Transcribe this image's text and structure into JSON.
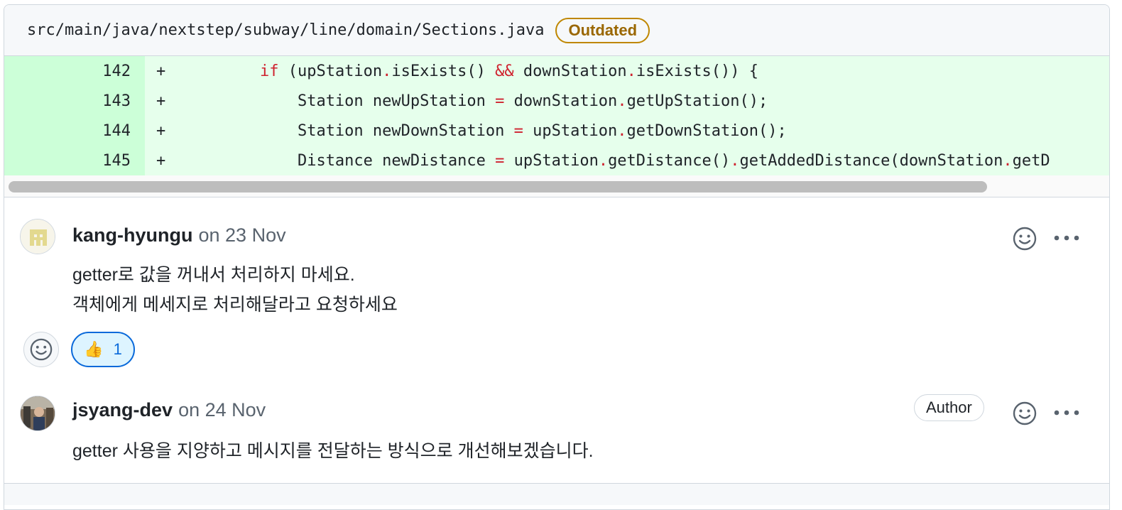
{
  "file": {
    "path": "src/main/java/nextstep/subway/line/domain/Sections.java",
    "badge": "Outdated"
  },
  "diff": [
    {
      "num": "142",
      "sign": "+"
    },
    {
      "num": "143",
      "sign": "+"
    },
    {
      "num": "144",
      "sign": "+"
    },
    {
      "num": "145",
      "sign": "+"
    }
  ],
  "code": {
    "l142": {
      "indent": "        ",
      "kw": "if",
      "a": " (upStation",
      "b": "isExists() ",
      "c": "&&",
      "d": " downStation",
      "e": "isExists()) {"
    },
    "l143": {
      "indent": "            ",
      "a": "Station newUpStation ",
      "eq": "=",
      "b": " downStation",
      "c": "getUpStation();"
    },
    "l144": {
      "indent": "            ",
      "a": "Station newDownStation ",
      "eq": "=",
      "b": " upStation",
      "c": "getDownStation();"
    },
    "l145": {
      "indent": "            ",
      "a": "Distance newDistance ",
      "eq": "=",
      "b": " upStation",
      "c": "getDistance()",
      "d": "getAddedDistance(downStation",
      "e": "getD"
    },
    "dot": "."
  },
  "comments": [
    {
      "author": "kang-hyungu",
      "date": "on 23 Nov",
      "lines": [
        "getter로 값을 꺼내서 처리하지 마세요.",
        "객체에게 메세지로 처리해달라고 요청하세요"
      ]
    },
    {
      "author": "jsyang-dev",
      "date": "on 24 Nov",
      "badge": "Author",
      "lines": [
        "getter 사용을 지양하고 메시지를 전달하는 방식으로 개선해보겠습니다."
      ]
    }
  ],
  "reaction": {
    "emoji": "👍",
    "count": "1"
  },
  "icons": [
    "smiley-icon",
    "kebab-horizontal-icon"
  ]
}
